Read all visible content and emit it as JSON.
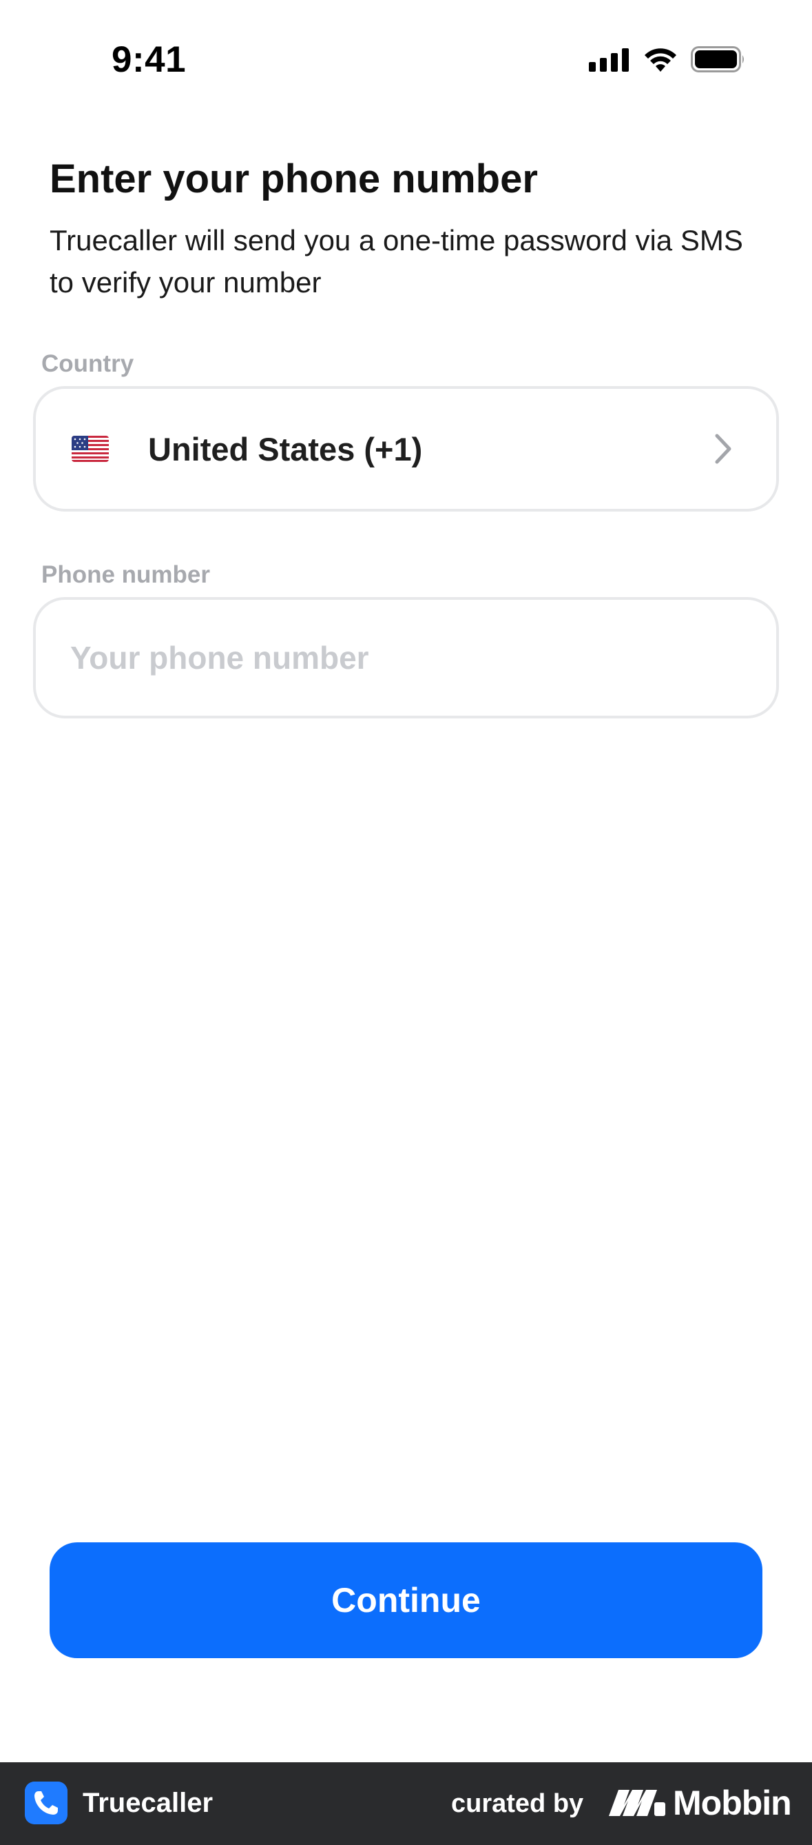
{
  "status_bar": {
    "time": "9:41",
    "icons": [
      "signal-icon",
      "wifi-icon",
      "battery-icon"
    ]
  },
  "header": {
    "title": "Enter your phone number",
    "subtitle": "Truecaller will send you a one-time password via SMS to verify your number"
  },
  "country_field": {
    "label": "Country",
    "value": "United States (+1)",
    "flag_icon": "us-flag-icon",
    "action_icon": "chevron-right-icon"
  },
  "phone_field": {
    "label": "Phone number",
    "placeholder": "Your phone number",
    "value": ""
  },
  "continue_button": {
    "label": "Continue"
  },
  "footer": {
    "app_name": "Truecaller",
    "curated_by": "curated by",
    "brand": "Mobbin"
  },
  "colors": {
    "accent": "#0c6efd",
    "label_gray": "#a7a9ae",
    "border_gray": "#e7e8ea",
    "footer_bg": "#2a2b2d"
  }
}
